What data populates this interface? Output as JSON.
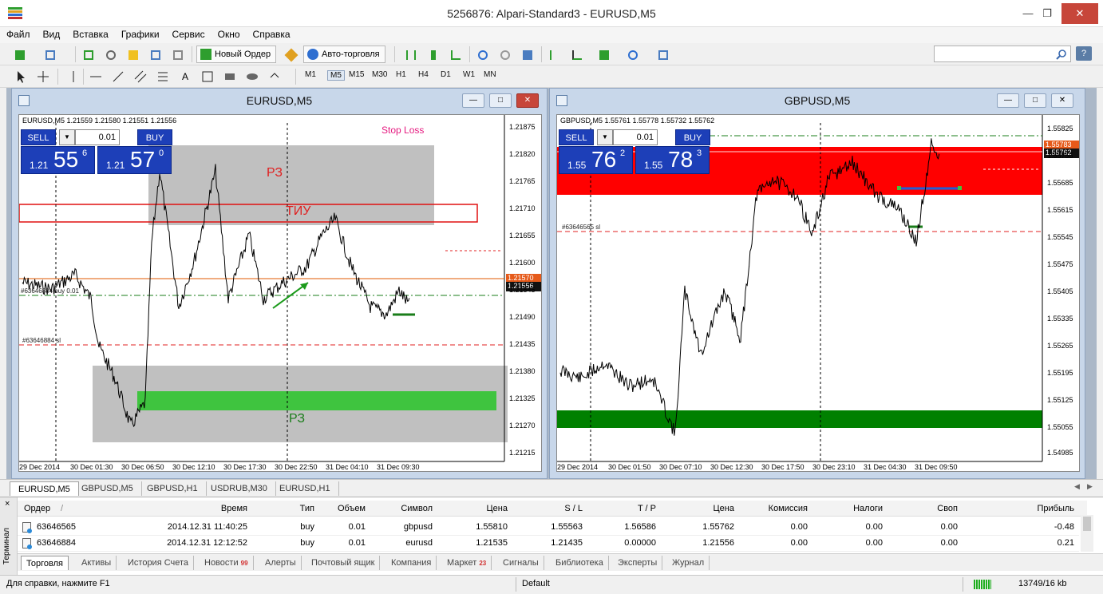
{
  "window": {
    "title": "5256876: Alpari-Standard3 - EURUSD,M5"
  },
  "menu": [
    "Файл",
    "Вид",
    "Вставка",
    "Графики",
    "Сервис",
    "Окно",
    "Справка"
  ],
  "toolbar": {
    "new_order": "Новый Ордер",
    "auto_trading": "Авто-торговля",
    "timeframes": [
      "M1",
      "M5",
      "M15",
      "M30",
      "H1",
      "H4",
      "D1",
      "W1",
      "MN"
    ],
    "text_tool": "A"
  },
  "charts": [
    {
      "title": "EURUSD,M5",
      "symbol_line": "EURUSD,M5  1.21559 1.21580 1.21551 1.21556",
      "trade_panel": {
        "sell": "SELL",
        "buy": "BUY",
        "lot": "0.01",
        "bid_small": "1.21",
        "bid_big": "55",
        "bid_sup": "6",
        "ask_small": "1.21",
        "ask_big": "57",
        "ask_sup": "0"
      },
      "labels": {
        "stop_loss": "Stop Loss",
        "zone_top": "РЗ",
        "tiu": "ТИУ",
        "zone_bottom": "РЗ",
        "order_line": "#63646884 buy 0.01",
        "sl_line": "#63646884 sl"
      },
      "price_axis": [
        "1.21875",
        "1.21820",
        "1.21765",
        "1.21710",
        "1.21655",
        "1.21600",
        "1.21545",
        "1.21490",
        "1.21435",
        "1.21380",
        "1.21325",
        "1.21270",
        "1.21215"
      ],
      "price_tags": [
        "1.21570",
        "1.21556"
      ],
      "time_axis": [
        "29 Dec 2014",
        "30 Dec 01:30",
        "30 Dec 06:50",
        "30 Dec 12:10",
        "30 Dec 17:30",
        "30 Dec 22:50",
        "31 Dec 04:10",
        "31 Dec 09:30"
      ]
    },
    {
      "title": "GBPUSD,M5",
      "symbol_line": "GBPUSD,M5  1.55761 1.55778 1.55732 1.55762",
      "trade_panel": {
        "sell": "SELL",
        "buy": "BUY",
        "lot": "0.01",
        "bid_small": "1.55",
        "bid_big": "76",
        "bid_sup": "2",
        "ask_small": "1.55",
        "ask_big": "78",
        "ask_sup": "3"
      },
      "labels": {
        "sl_line": "#63646565 sl"
      },
      "price_axis": [
        "1.55825",
        "1.55755",
        "1.55685",
        "1.55615",
        "1.55545",
        "1.55475",
        "1.55405",
        "1.55335",
        "1.55265",
        "1.55195",
        "1.55125",
        "1.55055",
        "1.54985"
      ],
      "price_tags": [
        "1.55783",
        "1.55762"
      ],
      "time_axis": [
        "29 Dec 2014",
        "30 Dec 01:50",
        "30 Dec 07:10",
        "30 Dec 12:30",
        "30 Dec 17:50",
        "30 Dec 23:10",
        "31 Dec 04:30",
        "31 Dec 09:50"
      ]
    }
  ],
  "chart_tabs": [
    "EURUSD,M5",
    "GBPUSD,M5",
    "GBPUSD,H1",
    "USDRUB,M30",
    "EURUSD,H1"
  ],
  "terminal": {
    "side_label": "Терминал",
    "close": "×",
    "columns": [
      "Ордер",
      "/",
      "Время",
      "Тип",
      "Объем",
      "Символ",
      "Цена",
      "S / L",
      "T / P",
      "Цена",
      "Комиссия",
      "Налоги",
      "Своп",
      "Прибыль"
    ],
    "rows": [
      [
        "63646565",
        "2014.12.31 11:40:25",
        "buy",
        "0.01",
        "gbpusd",
        "1.55810",
        "1.55563",
        "1.56586",
        "1.55762",
        "0.00",
        "0.00",
        "0.00",
        "-0.48"
      ],
      [
        "63646884",
        "2014.12.31 12:12:52",
        "buy",
        "0.01",
        "eurusd",
        "1.21535",
        "1.21435",
        "0.00000",
        "1.21556",
        "0.00",
        "0.00",
        "0.00",
        "0.21"
      ]
    ],
    "tabs": [
      {
        "label": "Торговля"
      },
      {
        "label": "Активы"
      },
      {
        "label": "История Счета"
      },
      {
        "label": "Новости",
        "badge": "99"
      },
      {
        "label": "Алерты"
      },
      {
        "label": "Почтовый ящик"
      },
      {
        "label": "Компания"
      },
      {
        "label": "Маркет",
        "badge": "23"
      },
      {
        "label": "Сигналы"
      },
      {
        "label": "Библиотека"
      },
      {
        "label": "Эксперты"
      },
      {
        "label": "Журнал"
      }
    ]
  },
  "status": {
    "help": "Для справки, нажмите F1",
    "profile": "Default",
    "traffic": "13749/16 kb"
  },
  "colors": {
    "zone_red": "#ff0000",
    "zone_green": "#008000",
    "zone_green_light": "#3fc43f",
    "zone_gray": "#c0c0c0",
    "panel_blue": "#1d3fb8",
    "stop_loss_text": "#e5197f"
  }
}
